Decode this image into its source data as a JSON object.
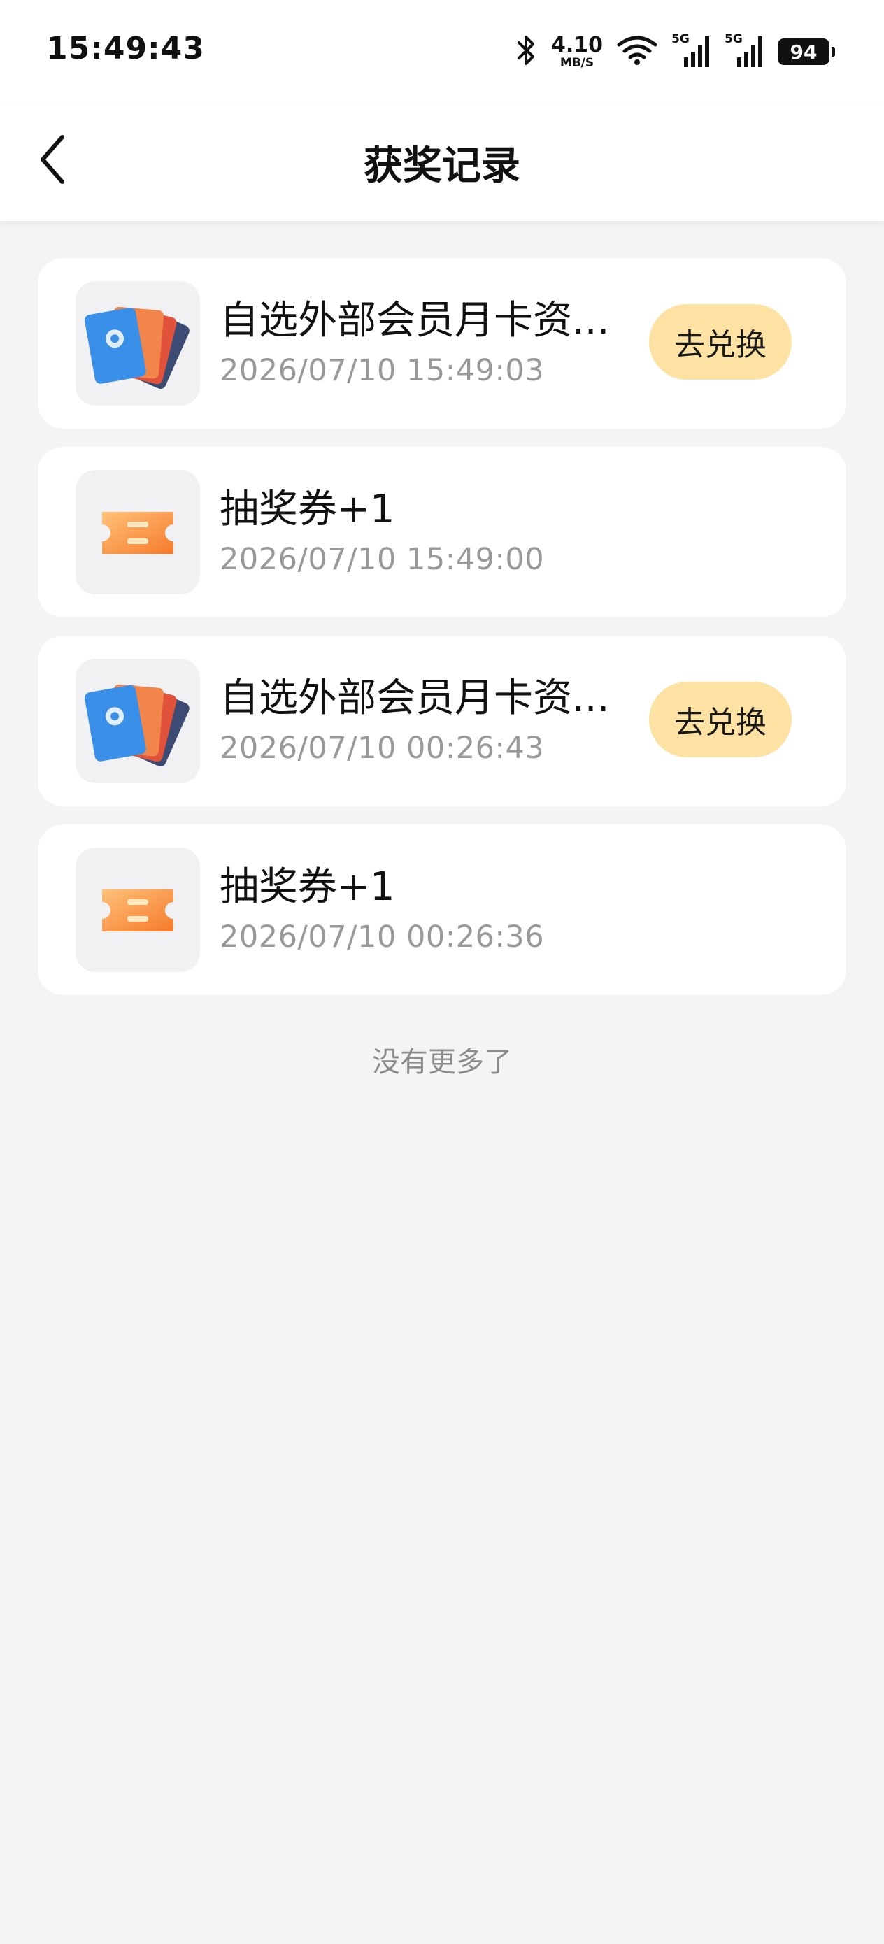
{
  "status_bar": {
    "time": "15:49:43",
    "net_speed_value": "4.10",
    "net_speed_unit": "MB/S",
    "sim1_tag": "5G",
    "sim2_tag": "5G",
    "battery": "94",
    "icons": [
      "bluetooth-icon",
      "wifi-icon",
      "signal-icon",
      "signal-icon",
      "battery-icon"
    ]
  },
  "header": {
    "title": "获奖记录",
    "back_icon": "chevron-left-icon"
  },
  "records": [
    {
      "title": "自选外部会员月卡资...",
      "time": "2026/07/10 15:49:03",
      "button": "去兑换",
      "icon": "member-cards-icon"
    },
    {
      "title": "抽奖券+1",
      "time": "2026/07/10 15:49:00",
      "button": "",
      "icon": "lottery-ticket-icon"
    },
    {
      "title": "自选外部会员月卡资...",
      "time": "2026/07/10 00:26:43",
      "button": "去兑换",
      "icon": "member-cards-icon"
    },
    {
      "title": "抽奖券+1",
      "time": "2026/07/10 00:26:36",
      "button": "",
      "icon": "lottery-ticket-icon"
    }
  ],
  "footer": {
    "no_more": "没有更多了"
  },
  "colors": {
    "page_bg": "#f4f4f5",
    "card_bg": "#ffffff",
    "button_bg": "#fde2a4",
    "secondary_text": "#999999"
  }
}
